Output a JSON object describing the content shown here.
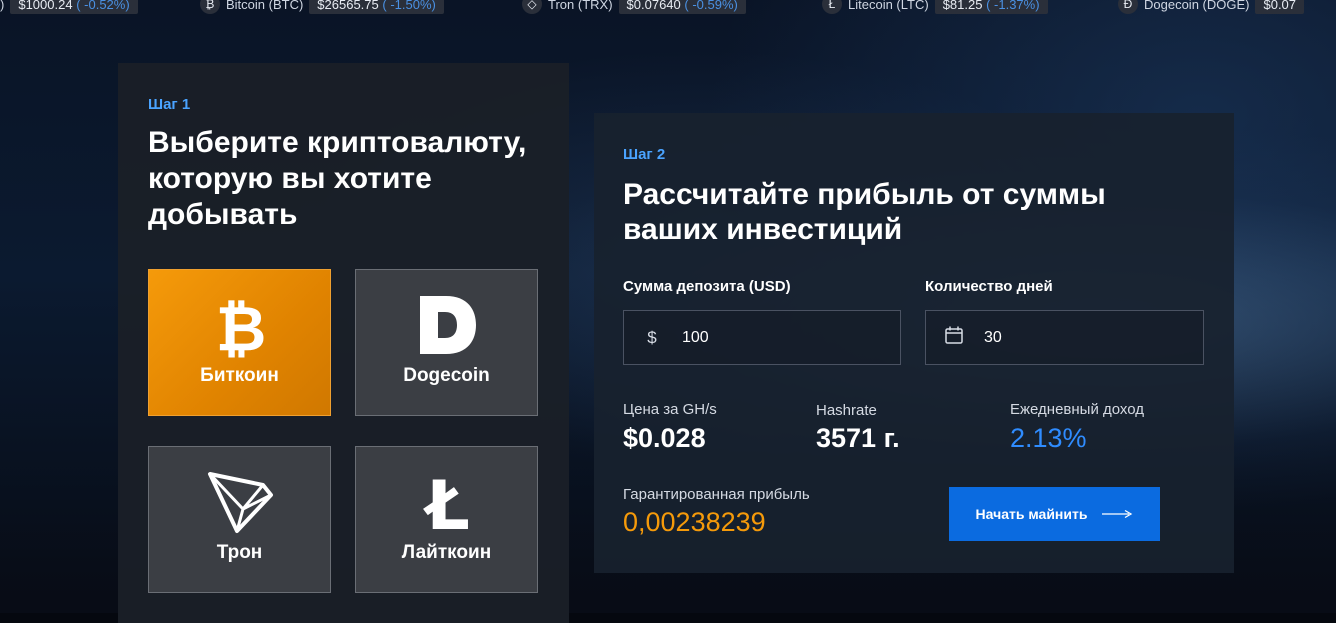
{
  "ticker": [
    {
      "icon": "",
      "name": ")",
      "price": "$1000.24",
      "change": "( -0.52%)"
    },
    {
      "icon": "₿",
      "name": "Bitcoin (BTC)",
      "price": "$26565.75",
      "change": "( -1.50%)"
    },
    {
      "icon": "◇",
      "name": "Tron (TRX)",
      "price": "$0.07640",
      "change": "( -0.59%)"
    },
    {
      "icon": "Ł",
      "name": "Litecoin (LTC)",
      "price": "$81.25",
      "change": "( -1.37%)"
    },
    {
      "icon": "Ð",
      "name": "Dogecoin (DOGE)",
      "price": "$0.07",
      "change": ""
    }
  ],
  "step1": {
    "label": "Шаг 1",
    "title": "Выберите криптовалюту, которую вы хотите добывать",
    "coins": [
      {
        "label": "Биткоин",
        "icon": "bitcoin-icon",
        "active": true
      },
      {
        "label": "Dogecoin",
        "icon": "dogecoin-icon",
        "active": false
      },
      {
        "label": "Трон",
        "icon": "tron-icon",
        "active": false
      },
      {
        "label": "Лайткоин",
        "icon": "litecoin-icon",
        "active": false
      }
    ]
  },
  "step2": {
    "label": "Шаг 2",
    "title": "Рассчитайте прибыль от суммы ваших инвестиций",
    "deposit_label": "Сумма депозита (USD)",
    "deposit_prefix": "$",
    "deposit_value": "100",
    "days_label": "Количество дней",
    "days_value": "30",
    "price_label": "Цена за GH/s",
    "price_value": "$0.028",
    "hashrate_label": "Hashrate",
    "hashrate_value": "3571 г.",
    "daily_label": "Ежедневный доход",
    "daily_value": "2.13%",
    "profit_label": "Гарантированная прибыль",
    "profit_value": "0,00238239",
    "cta_label": "Начать майнить"
  },
  "colors": {
    "accent_orange": "#f59a0a",
    "accent_blue": "#0b6be0",
    "step_blue": "#4aa3ff",
    "card_bg": "#1a1f28"
  }
}
